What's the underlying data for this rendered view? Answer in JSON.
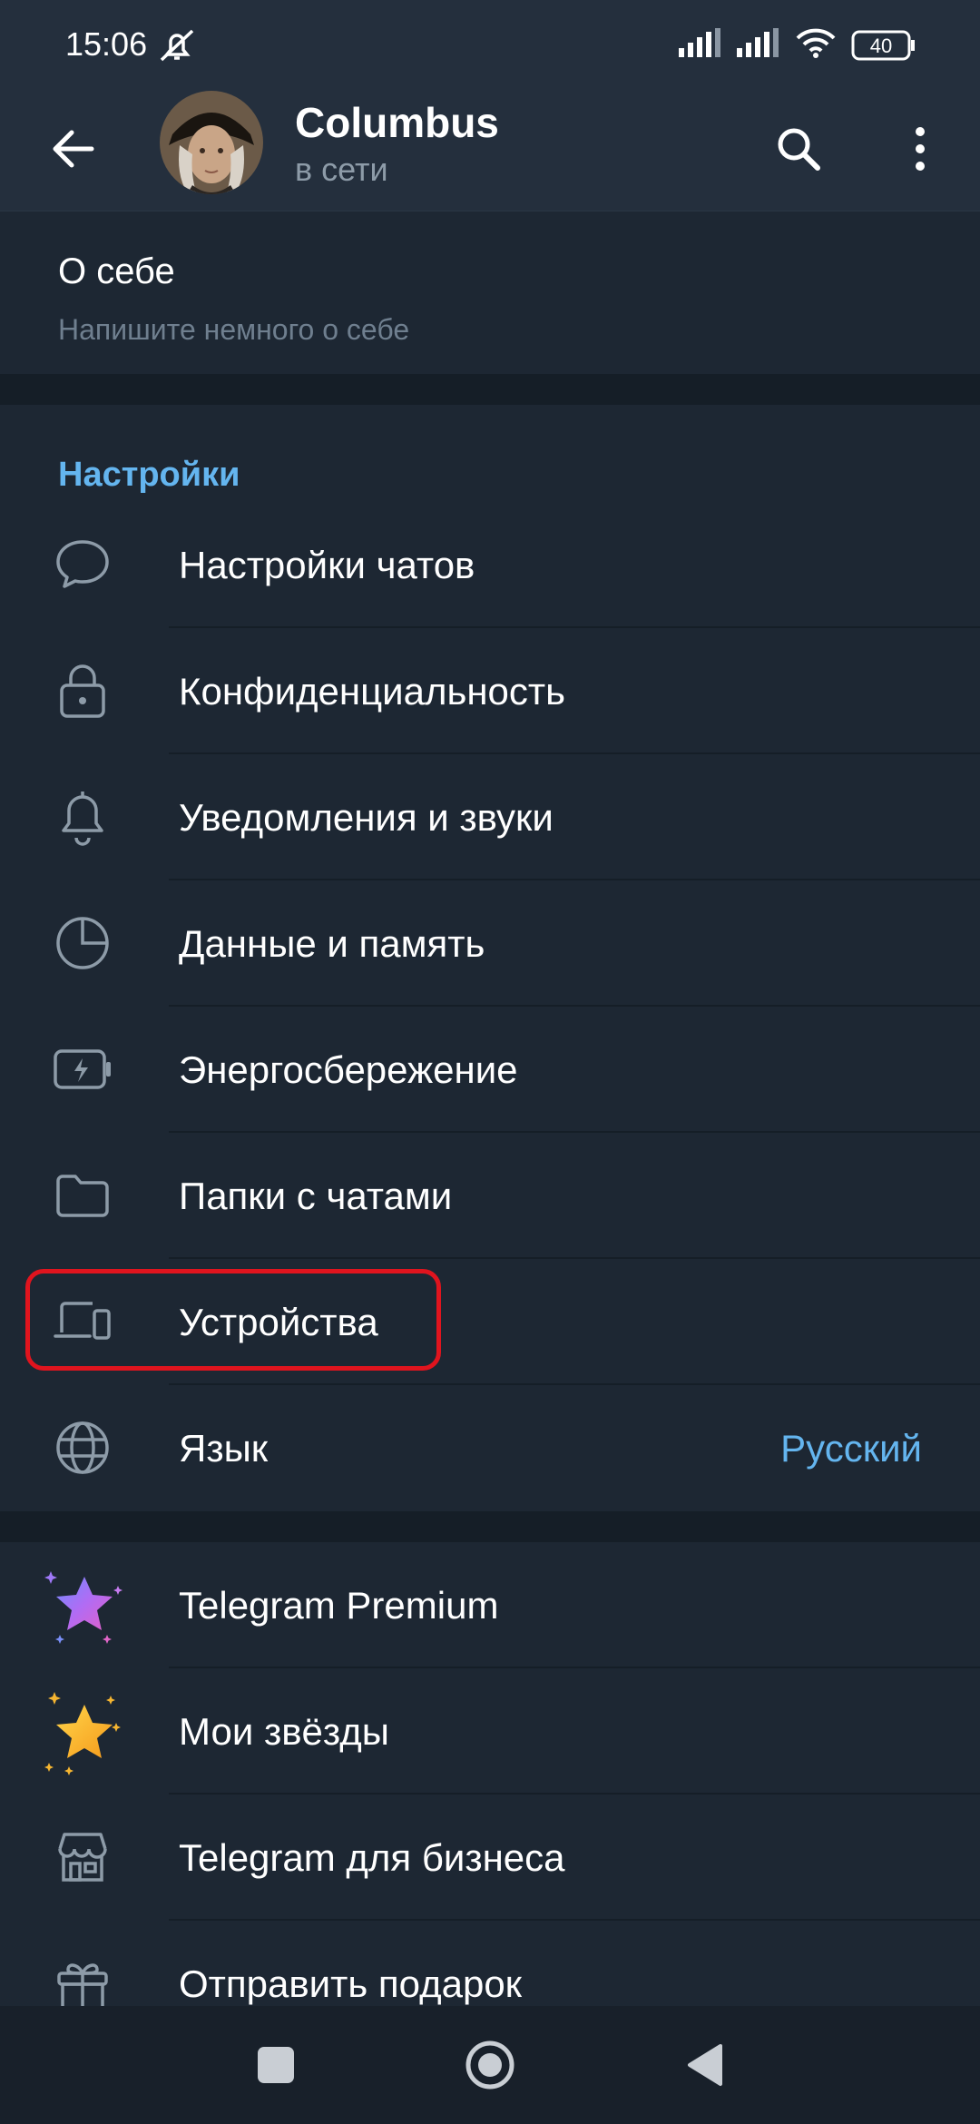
{
  "status_bar": {
    "time": "15:06",
    "battery": "40",
    "icons": [
      "mute-bell-icon",
      "signal-icon",
      "signal-icon",
      "wifi-icon",
      "battery-icon"
    ]
  },
  "header": {
    "title": "Columbus",
    "subtitle": "в сети",
    "back_icon": "arrow-left-icon",
    "search_icon": "search-icon",
    "menu_icon": "more-vertical-icon"
  },
  "about": {
    "title": "О себе",
    "hint": "Напишите немного о себе"
  },
  "settings": {
    "header": "Настройки",
    "items": [
      {
        "label": "Настройки чатов",
        "icon": "chat-bubble-icon"
      },
      {
        "label": "Конфиденциальность",
        "icon": "lock-icon"
      },
      {
        "label": "Уведомления и звуки",
        "icon": "bell-icon"
      },
      {
        "label": "Данные и память",
        "icon": "pie-chart-icon"
      },
      {
        "label": "Энергосбережение",
        "icon": "battery-bolt-icon"
      },
      {
        "label": "Папки с чатами",
        "icon": "folder-icon"
      },
      {
        "label": "Устройства",
        "icon": "devices-icon"
      },
      {
        "label": "Язык",
        "value": "Русский",
        "icon": "globe-icon"
      }
    ]
  },
  "extras": {
    "items": [
      {
        "label": "Telegram Premium",
        "icon": "premium-star-icon"
      },
      {
        "label": "Мои звёзды",
        "icon": "gold-star-icon"
      },
      {
        "label": "Telegram для бизнеса",
        "icon": "store-icon"
      },
      {
        "label": "Отправить подарок",
        "icon": "gift-icon"
      }
    ]
  },
  "colors": {
    "background": "#1d2733",
    "header": "#242f3d",
    "accent": "#64b5ef",
    "highlight": "#e0141e"
  }
}
